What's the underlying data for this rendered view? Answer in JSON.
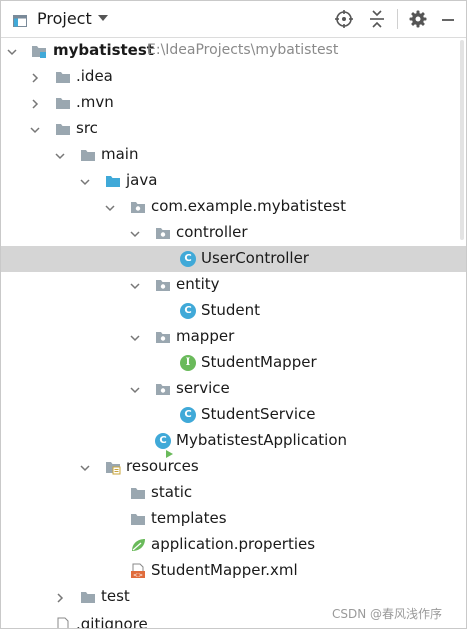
{
  "header": {
    "title": "Project"
  },
  "toolbar": {
    "locate": "locate-icon",
    "collapse": "collapse-all-icon",
    "settings": "gear-icon",
    "hide": "minimize-icon"
  },
  "tree": {
    "root": {
      "label": "mybatistest",
      "path": "E:\\IdeaProjects\\mybatistest"
    },
    "idea": ".idea",
    "mvn": ".mvn",
    "src": "src",
    "main": "main",
    "java": "java",
    "pkg": "com.example.mybatistest",
    "controller": "controller",
    "userController": "UserController",
    "entity": "entity",
    "student": "Student",
    "mapper": "mapper",
    "studentMapper": "StudentMapper",
    "service": "service",
    "studentService": "StudentService",
    "app": "MybatistestApplication",
    "resources": "resources",
    "static": "static",
    "templates": "templates",
    "appProps": "application.properties",
    "mapperXml": "StudentMapper.xml",
    "test": "test",
    "gitignore": ".gitignore"
  },
  "badges": {
    "class": "C",
    "interface": "I"
  },
  "watermark": "CSDN @春风浅作序",
  "colors": {
    "selection": "#d5d5d5",
    "folder": "#9aa7b0",
    "sourceFolder": "#40a9d8",
    "classIcon": "#40a9d8",
    "interfaceIcon": "#6aba5b",
    "spring": "#6aba5b",
    "xml": "#e06c3c"
  }
}
